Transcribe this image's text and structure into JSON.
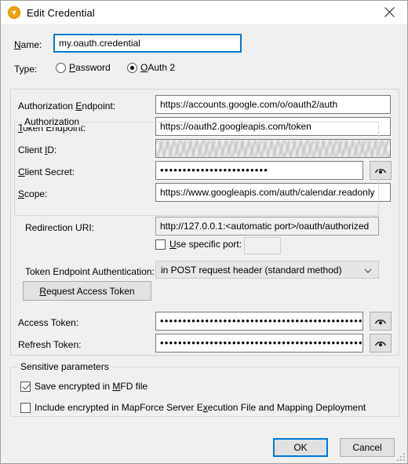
{
  "window": {
    "title": "Edit Credential",
    "icon": "credential-app-icon",
    "close_icon": "close-icon",
    "accent_color": "#0078d7",
    "icon_color": "#f0a30a"
  },
  "name_field": {
    "label": "Name:",
    "label_mnemonic": "N",
    "value": "my.oauth.credential",
    "placeholder": ""
  },
  "type_field": {
    "label": "Type:",
    "options": [
      {
        "label": "Password",
        "mnemonic": "P",
        "selected": false
      },
      {
        "label": "OAuth 2",
        "mnemonic": "O",
        "selected": true
      }
    ]
  },
  "oauth": {
    "rows": [
      {
        "label": "Authorization Endpoint:",
        "mnemonic": "E",
        "value": "https://accounts.google.com/o/oauth2/auth",
        "kind": "text"
      },
      {
        "label": "Token Endpoint:",
        "mnemonic": "T",
        "value": "https://oauth2.googleapis.com/token",
        "kind": "text"
      },
      {
        "label": "Client ID:",
        "mnemonic": "I",
        "value": "",
        "kind": "blurred"
      },
      {
        "label": "Client Secret:",
        "mnemonic": "C",
        "value": "••••••••••••••••••••••••",
        "kind": "password"
      },
      {
        "label": "Scope:",
        "mnemonic": "S",
        "value": "https://www.googleapis.com/auth/calendar.readonly",
        "kind": "text"
      }
    ]
  },
  "authorization": {
    "group_title": "Authorization",
    "redirection_uri": {
      "label": "Redirection URI:",
      "value": "http://127.0.0.1:<automatic port>/oauth/authorized",
      "readonly": true
    },
    "use_specific_port": {
      "label": "Use specific port:",
      "mnemonic": "U",
      "checked": false
    },
    "port_input": {
      "value": "",
      "disabled": true
    },
    "token_endpoint_auth": {
      "label": "Token Endpoint Authentication:",
      "selected": "in POST request header (standard method)"
    },
    "request_token_button": {
      "label": "Request Access Token",
      "mnemonic": "R"
    }
  },
  "tokens": [
    {
      "label": "Access Token:",
      "value": "•••••••••••••••••••••••••••••••••••••••••••••",
      "reveal_icon": "eye-icon"
    },
    {
      "label": "Refresh Token:",
      "value": "•••••••••••••••••••••••••••••••••••••••••••••",
      "reveal_icon": "eye-icon"
    }
  ],
  "sensitive": {
    "group_title": "Sensitive parameters",
    "options": [
      {
        "label": "Save encrypted in MFD file",
        "mnemonic": "M",
        "checked": true
      },
      {
        "label": "Include encrypted in MapForce Server Execution File and Mapping Deployment",
        "mnemonic": "x",
        "checked": false
      }
    ]
  },
  "footer": {
    "ok_label": "OK",
    "cancel_label": "Cancel"
  }
}
